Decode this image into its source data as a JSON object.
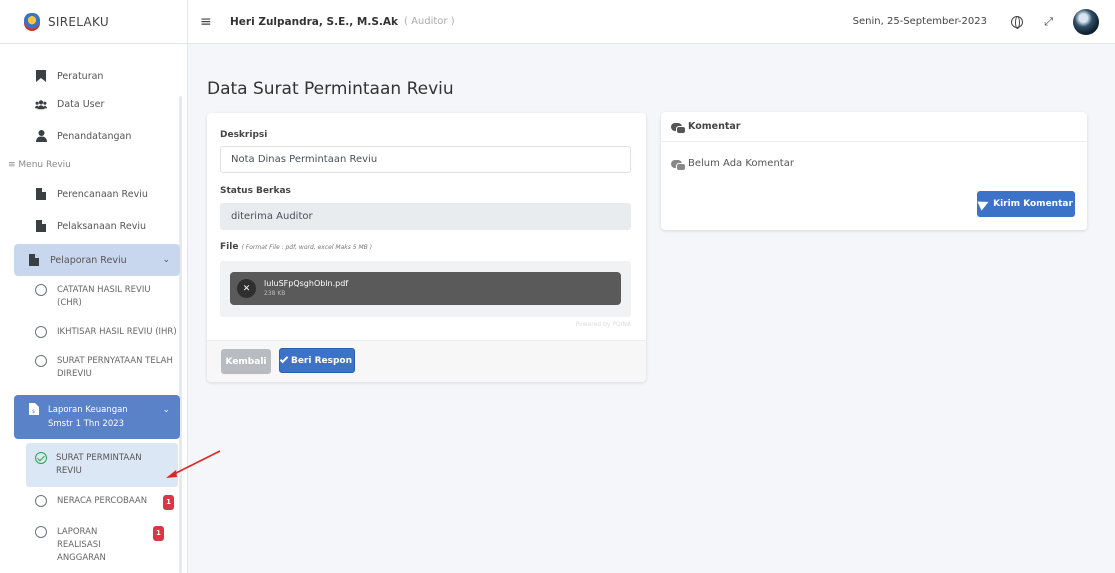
{
  "app": {
    "brand": "SIRELAKU"
  },
  "topbar": {
    "user_name": "Heri Zulpandra, S.E., M.S.Ak",
    "user_role": "( Auditor )",
    "date": "Senin, 25-September-2023"
  },
  "sidebar": {
    "items": [
      {
        "label": "Peraturan",
        "icon": "bookmark-icon"
      },
      {
        "label": "Data User",
        "icon": "users-icon"
      },
      {
        "label": "Penandatangan",
        "icon": "user-icon"
      }
    ],
    "menu_header": "≡ Menu Reviu",
    "reviu_items": [
      {
        "label": "Perencanaan Reviu",
        "icon": "file-icon"
      },
      {
        "label": "Pelaksanaan Reviu",
        "icon": "file-icon"
      },
      {
        "label": "Pelaporan Reviu",
        "icon": "file-icon"
      }
    ],
    "pelaporan_sub": [
      {
        "label": "CATATAN HASIL REVIU (CHR)"
      },
      {
        "label": "IKHTISAR HASIL REVIU (IHR)"
      },
      {
        "label": "SURAT PERNYATAAN TELAH DIREVIU"
      }
    ],
    "laporan_group": "Laporan Keuangan Smstr 1 Thn 2023",
    "laporan_sub": [
      {
        "label": "SURAT PERMINTAAN REVIU",
        "active": true
      },
      {
        "label": "NERACA PERCOBAAN",
        "badge": "1"
      },
      {
        "label": "LAPORAN REALISASI ANGGARAN",
        "badge": "1"
      }
    ]
  },
  "main": {
    "title": "Data Surat Permintaan Reviu",
    "form": {
      "deskripsi_label": "Deskripsi",
      "deskripsi_value": "Nota Dinas Permintaan Reviu",
      "status_label": "Status Berkas",
      "status_value": "diterima Auditor",
      "file_label": "File",
      "file_hint": "( Format File : pdf, word, excel Maks 5 MB )",
      "file_name": "luluSFpQsghObln.pdf",
      "file_size": "238 KB",
      "powered_by": "Powered by PQINA",
      "back_button": "Kembali",
      "respond_button": "Beri Respon"
    },
    "comments": {
      "header": "Komentar",
      "empty_text": "Belum Ada Komentar",
      "send_button": "Kirim Komentar"
    }
  },
  "colors": {
    "primary": "#3c72c8",
    "sidebar_active": "#5a82c8",
    "badge": "#dc3545",
    "annotation_arrow": "#e02424"
  }
}
